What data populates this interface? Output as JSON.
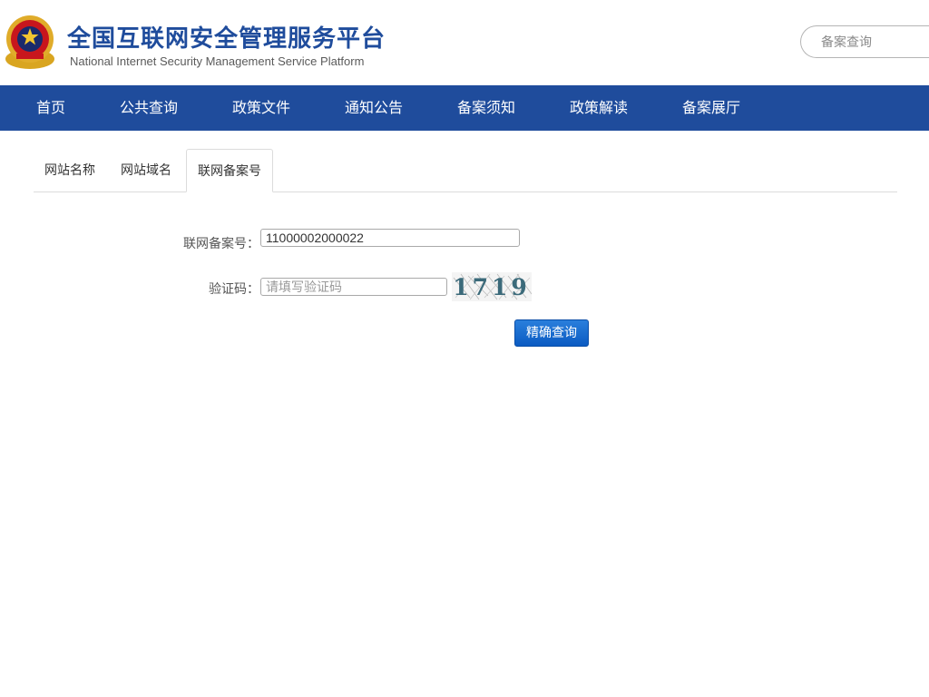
{
  "header": {
    "title": "全国互联网安全管理服务平台",
    "subtitle": "National Internet Security Management Service Platform",
    "search_placeholder": "备案查询"
  },
  "nav": {
    "items": [
      {
        "label": "首页"
      },
      {
        "label": "公共查询"
      },
      {
        "label": "政策文件"
      },
      {
        "label": "通知公告"
      },
      {
        "label": "备案须知"
      },
      {
        "label": "政策解读"
      },
      {
        "label": "备案展厅"
      }
    ]
  },
  "tabs": [
    {
      "label": "网站名称"
    },
    {
      "label": "网站域名"
    },
    {
      "label": "联网备案号",
      "active": true
    }
  ],
  "form": {
    "record_label": "联网备案号：",
    "record_value": "11000002000022",
    "captcha_label": "验证码：",
    "captcha_placeholder": "请填写验证码",
    "captcha_text": "1719",
    "submit_label": "精确查询"
  },
  "colors": {
    "brand_blue": "#1f4c9c",
    "button_blue": "#0b5bc2"
  }
}
